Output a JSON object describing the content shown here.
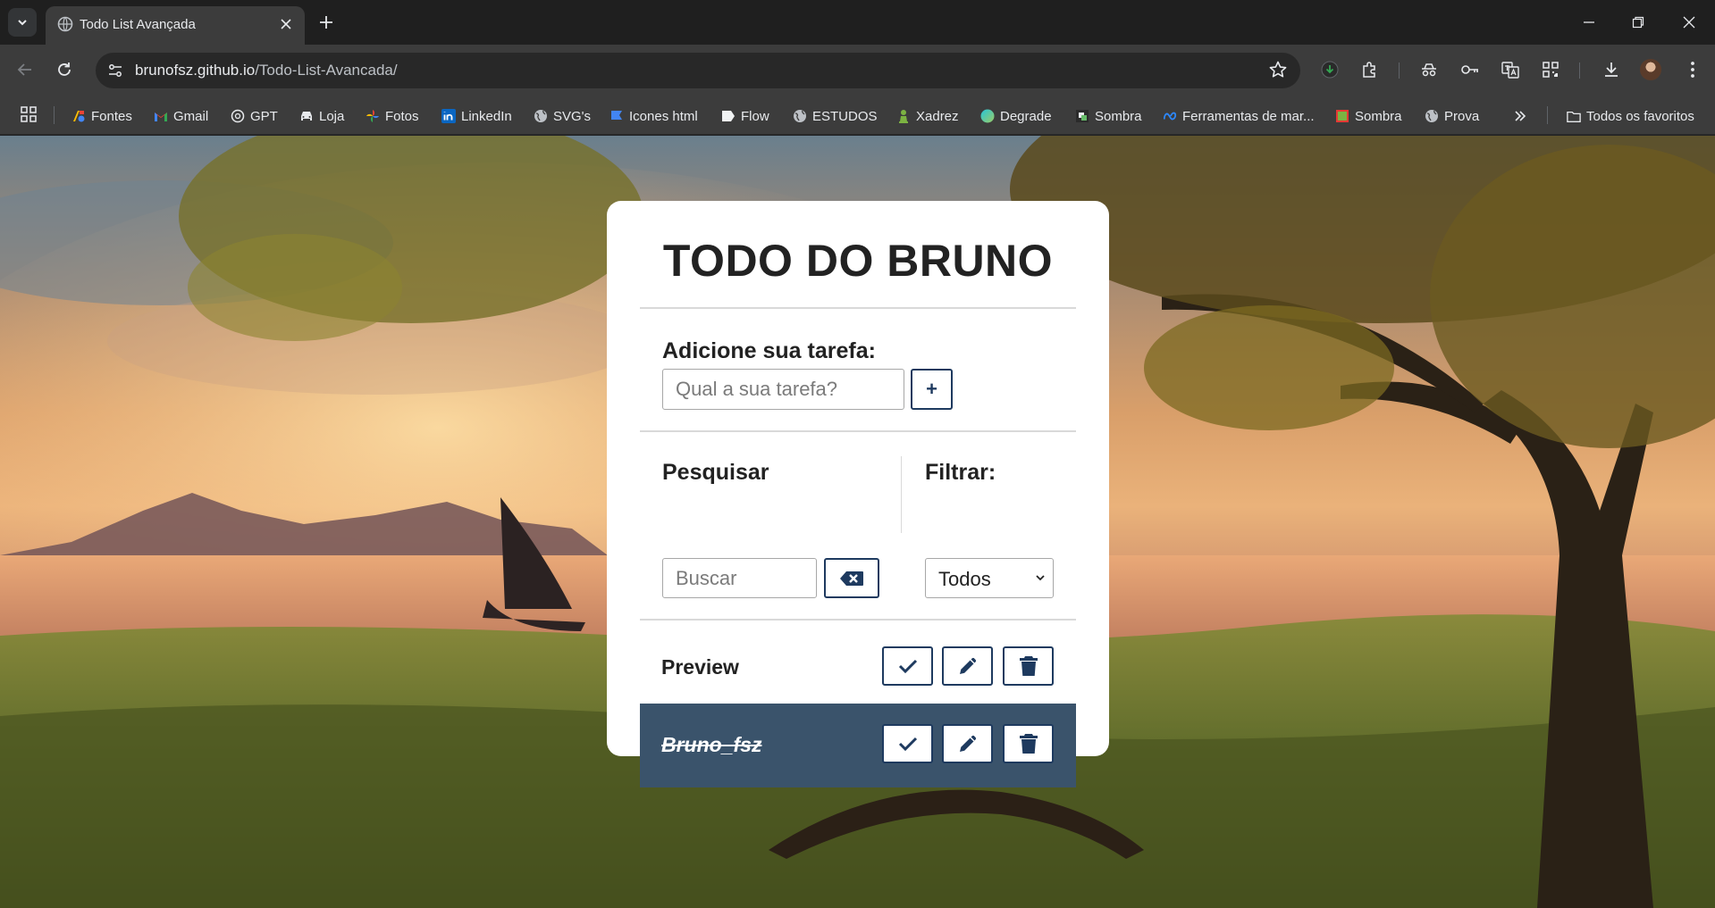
{
  "browser": {
    "tab_title": "Todo List Avançada",
    "url_host": "brunofsz.github.io",
    "url_path": "/Todo-List-Avancada/"
  },
  "bookmarks": {
    "items": [
      {
        "label": "Fontes",
        "icon": "google-fonts-icon"
      },
      {
        "label": "Gmail",
        "icon": "gmail-icon"
      },
      {
        "label": "GPT",
        "icon": "chatgpt-icon"
      },
      {
        "label": "Loja",
        "icon": "car-icon"
      },
      {
        "label": "Fotos",
        "icon": "google-photos-icon"
      },
      {
        "label": "LinkedIn",
        "icon": "linkedin-icon"
      },
      {
        "label": "SVG's",
        "icon": "globe-icon"
      },
      {
        "label": "Icones html",
        "icon": "flag-icon"
      },
      {
        "label": "Flow",
        "icon": "flow-icon"
      },
      {
        "label": "ESTUDOS",
        "icon": "globe-icon"
      },
      {
        "label": "Xadrez",
        "icon": "chess-pawn-icon"
      },
      {
        "label": "Degrade",
        "icon": "gradient-icon"
      },
      {
        "label": "Sombra",
        "icon": "sombra-icon"
      },
      {
        "label": "Ferramentas de mar...",
        "icon": "meta-icon"
      },
      {
        "label": "Sombra",
        "icon": "sombra-square-icon"
      },
      {
        "label": "Prova",
        "icon": "globe-icon"
      }
    ],
    "all_bookmarks": "Todos os favoritos"
  },
  "app": {
    "title": "TODO DO BRUNO",
    "add": {
      "label": "Adicione sua tarefa:",
      "placeholder": "Qual a sua tarefa?",
      "button": "+"
    },
    "search": {
      "label": "Pesquisar",
      "placeholder": "Buscar"
    },
    "filter": {
      "label": "Filtrar:",
      "selected": "Todos"
    },
    "todos": [
      {
        "title": "Preview",
        "done": false
      },
      {
        "title": "Bruno_fsz",
        "done": true
      }
    ]
  },
  "colors": {
    "accent": "#1e3a5f",
    "done_background": "#3a536b"
  }
}
